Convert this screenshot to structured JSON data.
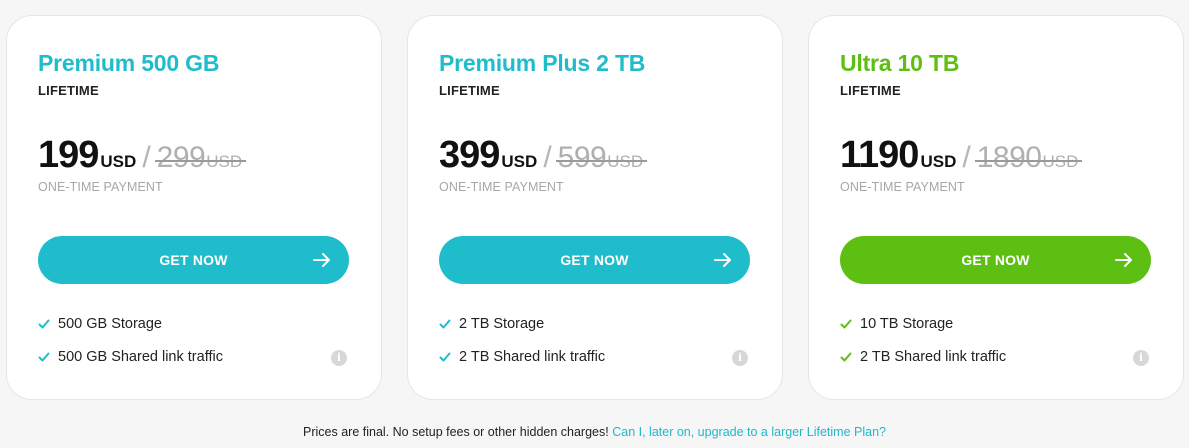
{
  "colors": {
    "teal": "#1fbccb",
    "green": "#5dbf12",
    "muted_text": "#a7a7a7",
    "link": "#21b8c9"
  },
  "plans": [
    {
      "title": "Premium 500 GB",
      "period": "LIFETIME",
      "price": "199",
      "currency": "USD",
      "separator": "/",
      "old_price": "299",
      "old_currency": "USD",
      "payment_note": "ONE-TIME PAYMENT",
      "cta_label": "GET NOW",
      "accent": "#1fbccb",
      "features": [
        "500 GB Storage",
        "500 GB Shared link traffic"
      ],
      "icons": {
        "check": "check-icon",
        "info": "info-icon",
        "arrow": "arrow-right-icon"
      }
    },
    {
      "title": "Premium Plus 2 TB",
      "period": "LIFETIME",
      "price": "399",
      "currency": "USD",
      "separator": "/",
      "old_price": "599",
      "old_currency": "USD",
      "payment_note": "ONE-TIME PAYMENT",
      "cta_label": "GET NOW",
      "accent": "#1fbccb",
      "features": [
        "2 TB Storage",
        "2 TB Shared link traffic"
      ],
      "icons": {
        "check": "check-icon",
        "info": "info-icon",
        "arrow": "arrow-right-icon"
      }
    },
    {
      "title": "Ultra 10 TB",
      "period": "LIFETIME",
      "price": "1190",
      "currency": "USD",
      "separator": "/",
      "old_price": "1890",
      "old_currency": "USD",
      "payment_note": "ONE-TIME PAYMENT",
      "cta_label": "GET NOW",
      "accent": "#5dbf12",
      "features": [
        "10 TB Storage",
        "2 TB Shared link traffic"
      ],
      "icons": {
        "check": "check-icon",
        "info": "info-icon",
        "arrow": "arrow-right-icon"
      }
    }
  ],
  "info_glyph": "i",
  "footer": {
    "text": "Prices are final. No setup fees or other hidden charges!",
    "link": "Can I, later on, upgrade to a larger Lifetime Plan?"
  }
}
